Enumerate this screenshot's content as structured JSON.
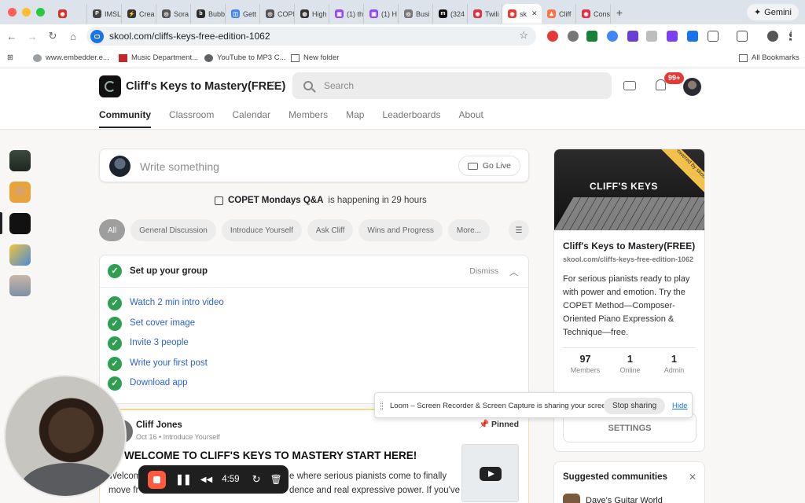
{
  "browser": {
    "tabs": [
      {
        "label": "",
        "color": "#d93025",
        "glyph": "◉"
      },
      {
        "label": "IMSL",
        "color": "#444444",
        "glyph": "P"
      },
      {
        "label": "Crea",
        "color": "#333333",
        "glyph": "⚡"
      },
      {
        "label": "Sora",
        "color": "#555555",
        "glyph": "◎"
      },
      {
        "label": "Bubb",
        "color": "#2c2c2c",
        "glyph": "b"
      },
      {
        "label": "Gett",
        "color": "#4285f4",
        "glyph": "◫"
      },
      {
        "label": "COPI",
        "color": "#555555",
        "glyph": "◎"
      },
      {
        "label": "High",
        "color": "#333333",
        "glyph": "◍"
      },
      {
        "label": "(1) th",
        "color": "#9146ff",
        "glyph": "▣"
      },
      {
        "label": "(1) H",
        "color": "#9146ff",
        "glyph": "▣"
      },
      {
        "label": "Busi",
        "color": "#777777",
        "glyph": "◎"
      },
      {
        "label": "(324",
        "color": "#111111",
        "glyph": "m"
      },
      {
        "label": "Twili",
        "color": "#e22f40",
        "glyph": "◉"
      },
      {
        "label": "sk",
        "color": "#e53935",
        "glyph": "◉"
      },
      {
        "label": "Cliff",
        "color": "#ff7043",
        "glyph": "♟"
      },
      {
        "label": "Cons",
        "color": "#e22f40",
        "glyph": "◉"
      }
    ],
    "new_tab": "+",
    "gemini": "Gemini",
    "url": "skool.com/cliffs-keys-free-edition-1062",
    "bookmarks": [
      "www.embedder.e...",
      "Music Department...",
      "YouTube to MP3 C...",
      "New folder"
    ],
    "all_bookmarks": "All Bookmarks"
  },
  "group": {
    "name": "Cliff's Keys to Mastery(FREE)",
    "search_placeholder": "Search",
    "notifications": "99+"
  },
  "nav": [
    "Community",
    "Classroom",
    "Calendar",
    "Members",
    "Map",
    "Leaderboards",
    "About"
  ],
  "composer": {
    "placeholder": "Write something",
    "go_live": "Go Live"
  },
  "event": {
    "name": "COPET Mondays Q&A",
    "suffix": "is happening in 29 hours"
  },
  "filters": [
    "All",
    "General Discussion",
    "Introduce Yourself",
    "Ask Cliff",
    "Wins and Progress",
    "More..."
  ],
  "setup": {
    "title": "Set up your group",
    "dismiss": "Dismiss",
    "tasks": [
      "Watch 2 min intro video",
      "Set cover image",
      "Invite 3 people",
      "Write your first post",
      "Download app"
    ]
  },
  "post": {
    "author": "Cliff Jones",
    "date": "Oct 16",
    "category": "Introduce Yourself",
    "pinned": "Pinned",
    "title": "WELCOME TO CLIFF'S KEYS TO MASTERY START HERE!",
    "line1a": "Welcom",
    "line1b": "e where serious pianists come to finally",
    "line2a": "move fr",
    "line2b": "dence and real expressive power. If you've"
  },
  "about": {
    "banner_text": "CLIFF'S KEYS",
    "ribbon": "Powered by skool",
    "name": "Cliff's Keys to Mastery(FREE)",
    "url": "skool.com/cliffs-keys-free-edition-1062",
    "description": "For serious pianists ready to play with power and emotion. Try the COPET Method—Composer-Oriented Piano Expression & Technique—free.",
    "stats": [
      {
        "value": "97",
        "label": "Members"
      },
      {
        "value": "1",
        "label": "Online"
      },
      {
        "value": "1",
        "label": "Admin"
      }
    ],
    "settings": "SETTINGS"
  },
  "suggested": {
    "title": "Suggested communities",
    "first": "Dave's Guitar World"
  },
  "loom": {
    "message": "Loom – Screen Recorder & Screen Capture is sharing your screen.",
    "stop": "Stop sharing",
    "hide": "Hide"
  },
  "recorder": {
    "time": "4:59"
  }
}
